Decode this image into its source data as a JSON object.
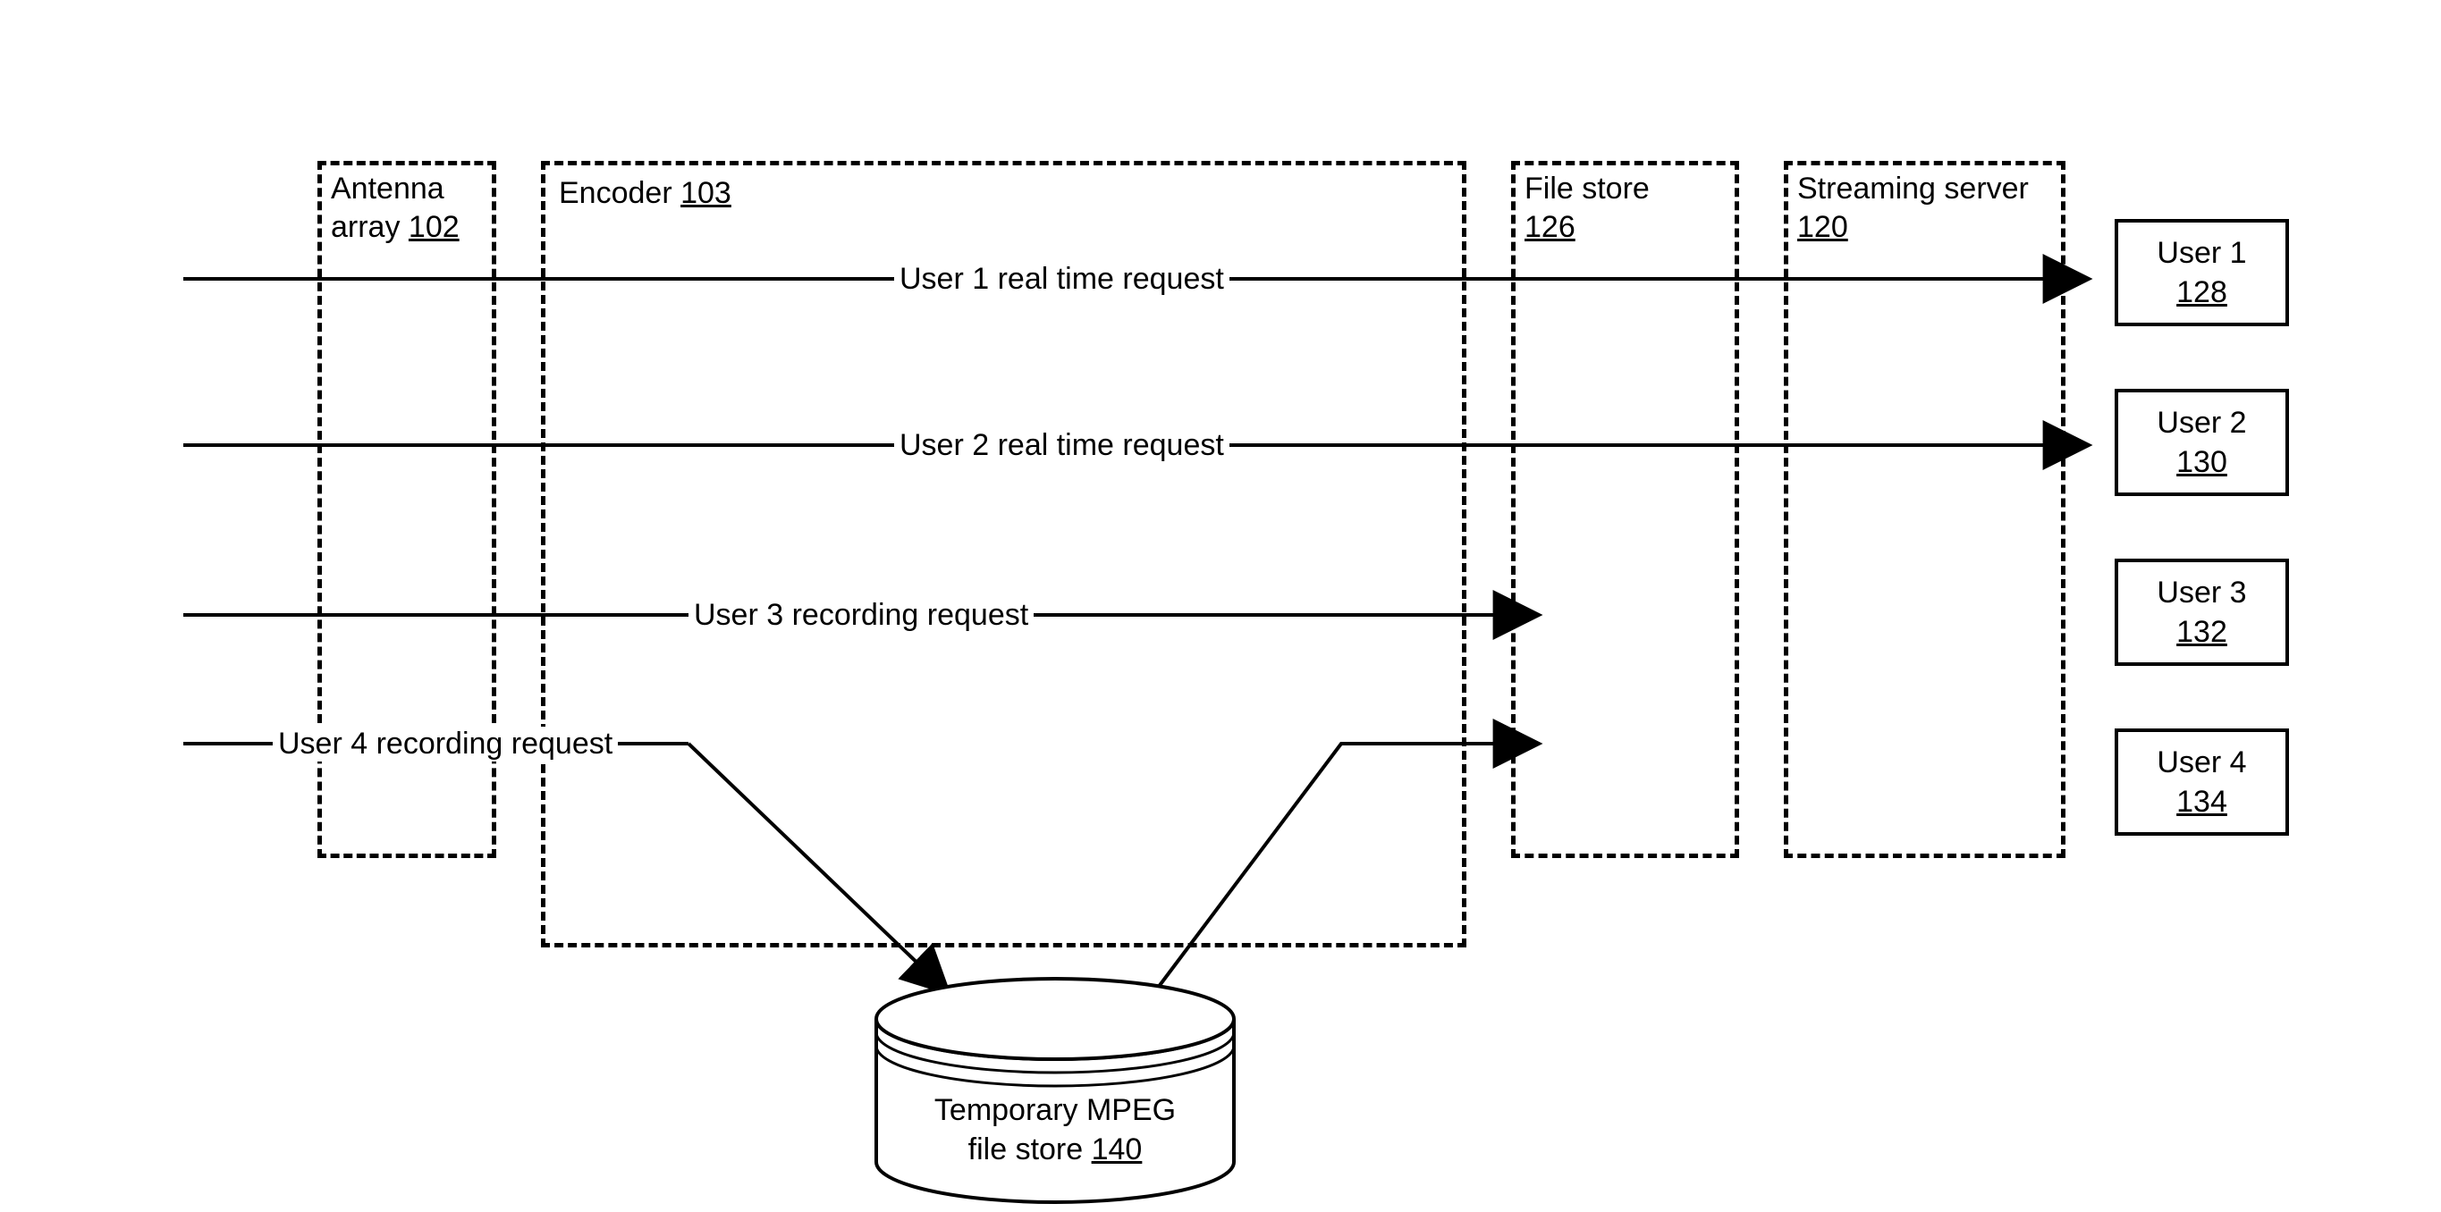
{
  "boxes": {
    "antenna": {
      "label": "Antenna array",
      "ref": "102"
    },
    "encoder": {
      "label": "Encoder",
      "ref": "103"
    },
    "filestore": {
      "label": "File store",
      "ref": "126"
    },
    "streamserver": {
      "label": "Streaming server",
      "ref": "120"
    }
  },
  "flows": {
    "u1": "User 1 real time request",
    "u2": "User 2 real time request",
    "u3": "User 3 recording request",
    "u4": "User 4 recording request"
  },
  "users": {
    "u1": {
      "label": "User 1",
      "ref": "128"
    },
    "u2": {
      "label": "User 2",
      "ref": "130"
    },
    "u3": {
      "label": "User 3",
      "ref": "132"
    },
    "u4": {
      "label": "User 4",
      "ref": "134"
    }
  },
  "cylinder": {
    "label1": "Temporary MPEG",
    "label2": "file store",
    "ref": "140"
  }
}
